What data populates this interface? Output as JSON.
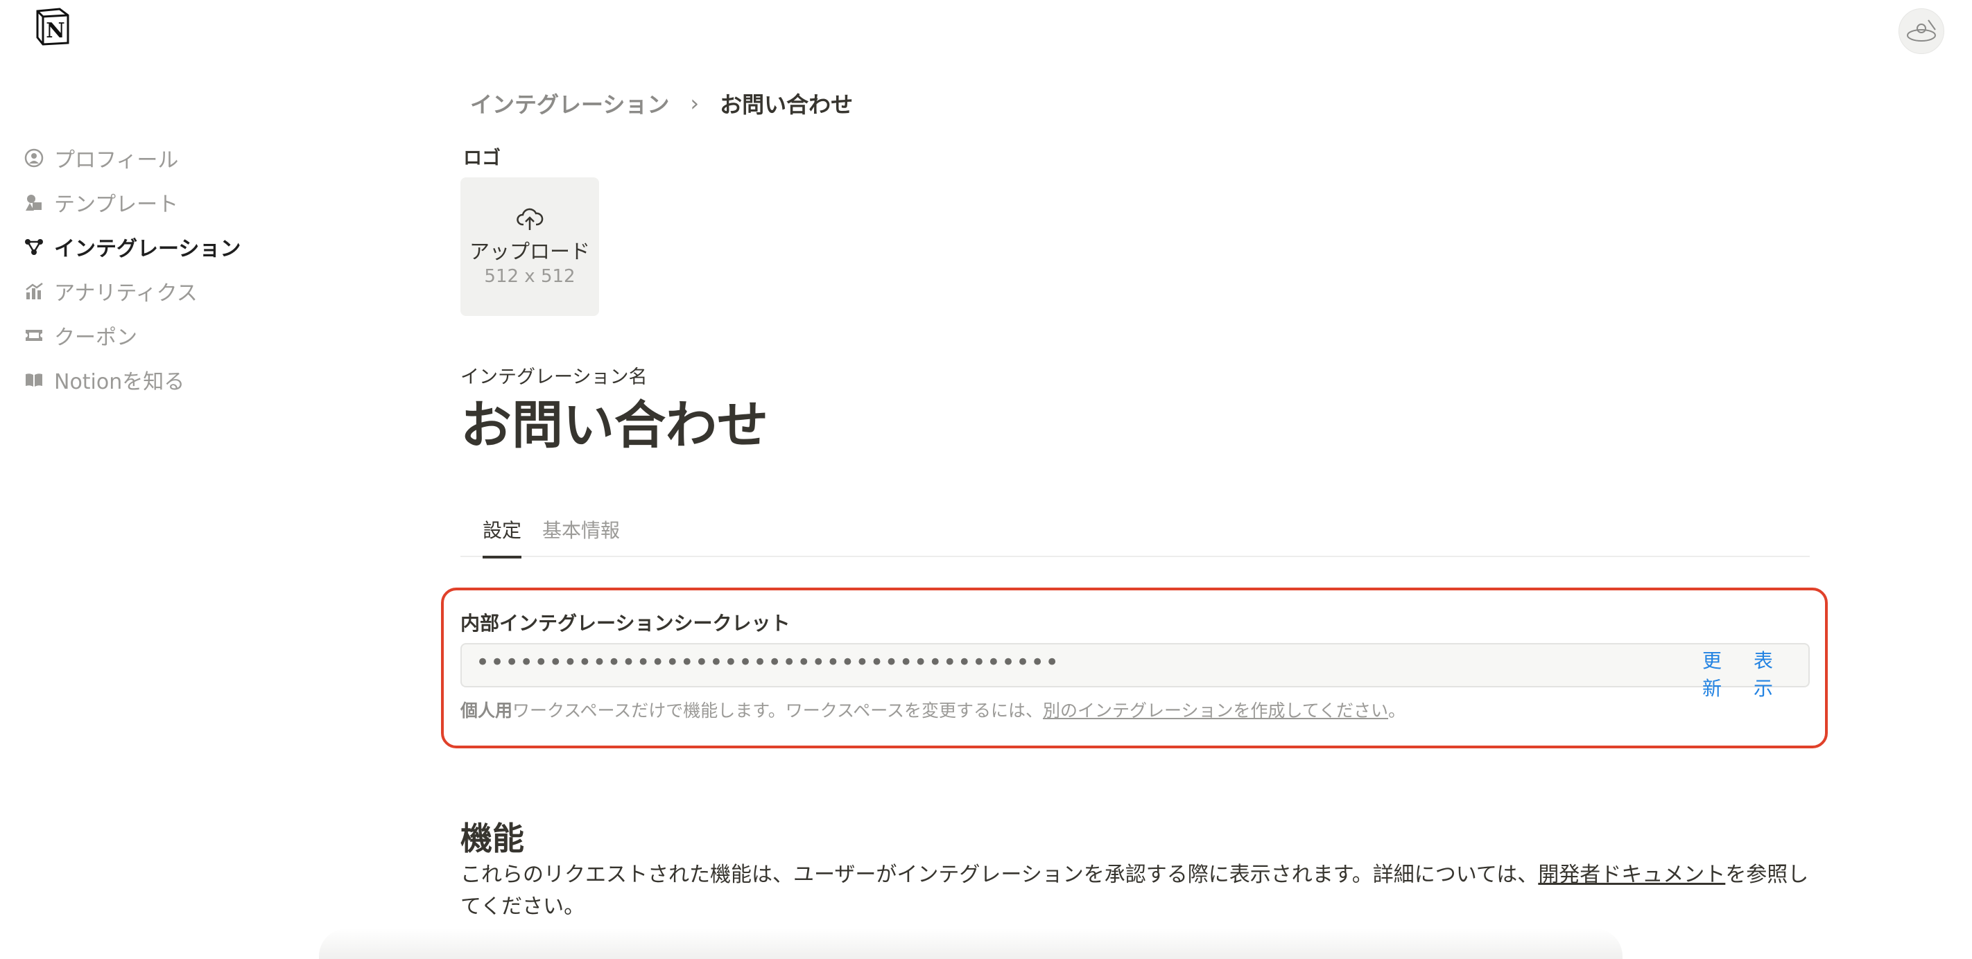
{
  "app": {
    "logo_letter": "N"
  },
  "sidebar": {
    "items": [
      {
        "label": "プロフィール",
        "icon": "user-circle-icon",
        "active": false
      },
      {
        "label": "テンプレート",
        "icon": "shapes-icon",
        "active": false
      },
      {
        "label": "インテグレーション",
        "icon": "nodes-icon",
        "active": true
      },
      {
        "label": "アナリティクス",
        "icon": "chart-icon",
        "active": false
      },
      {
        "label": "クーポン",
        "icon": "ticket-icon",
        "active": false
      },
      {
        "label": "Notionを知る",
        "icon": "book-icon",
        "active": false
      }
    ]
  },
  "breadcrumb": {
    "parent": "インテグレーション",
    "separator": "›",
    "current": "お問い合わせ"
  },
  "logo_section": {
    "label": "ロゴ",
    "upload_label": "アップロード",
    "size_hint": "512 x 512"
  },
  "integration_name": {
    "label": "インテグレーション名",
    "value": "お問い合わせ"
  },
  "tabs": [
    {
      "label": "設定",
      "active": true
    },
    {
      "label": "基本情報",
      "active": false
    }
  ],
  "secret": {
    "label": "内部インテグレーションシークレット",
    "masked_value": "••••••••••••••••••••••••••••••••••••••••",
    "refresh_label": "更新",
    "show_label": "表示",
    "hint_bold": "個人用",
    "hint_text": "ワークスペースだけで機能します。ワークスペースを変更するには、",
    "hint_link": "別のインテグレーションを作成してください",
    "hint_end": "。"
  },
  "capabilities": {
    "title": "機能",
    "description": "これらのリクエストされた機能は、ユーザーがインテグレーションを承認する際に表示されます。詳細については、",
    "link": "開発者ドキュメント",
    "description_end": "を参照してください。"
  },
  "colors": {
    "accent": "#2383e2",
    "highlight_border": "#e0412a",
    "text": "#37352f",
    "muted": "#9b9a97"
  }
}
